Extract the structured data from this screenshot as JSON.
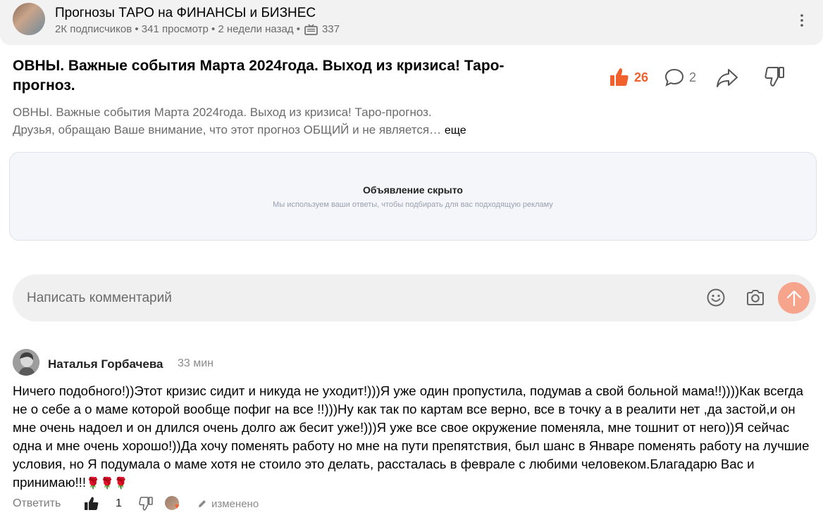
{
  "channel": {
    "name": "Прогнозы ТАРО на ФИНАНСЫ и БИЗНЕС",
    "meta": "2К подписчиков • 341 просмотр • 2 недели назад  •",
    "video_count": "337"
  },
  "article": {
    "title": "ОВНЫ. Важные события Марта 2024года. Выход из кризиса! Таро-прогноз.",
    "description_line1": "ОВНЫ. Важные события Марта 2024года. Выход из кризиса! Таро-прогноз.",
    "description_line2": "Друзья, обращаю Ваше внимание, что этот прогноз ОБЩИЙ и не является…",
    "more_label": "еще",
    "likes": "26",
    "comments": "2"
  },
  "ad": {
    "title": "Объявление скрыто",
    "subtitle": "Мы используем ваши ответы, чтобы подбирать для вас подходящую рекламу"
  },
  "comment_input": {
    "placeholder": "Написать комментарий"
  },
  "comment": {
    "author": "Наталья Горбачева",
    "time": "33 мин",
    "text": "Ничего подобного!))Этот кризис сидит и никуда не уходит!)))Я уже один пропустила, подумав а свой больной мама!!))))Как всегда не о себе а о маме которой вообще пофиг на все !!)))Ну как так по картам все верно, все в точку а в реалити нет ,да застой,и он мне очень надоел и он длился очень долго аж бесит уже!)))Я уже все свое окружение поменяла, мне тошнит от него))Я сейчас одна и мне очень хорошо!))Да хочу поменять работу но мне на пути препятствия, был шанс в Январе поменять работу на лучшие условия, но Я подумала о маме хотя не стоило это делать, рассталась в феврале с любими человеком.Благадарю Вас и принимаю!!!",
    "emoji": "🌹🌹🌹",
    "reply_label": "Ответить",
    "likes": "1",
    "edited_label": "изменено"
  },
  "colors": {
    "accent": "#f0612d",
    "send_button": "#f7a48c",
    "muted_text": "#6b6b6b"
  }
}
